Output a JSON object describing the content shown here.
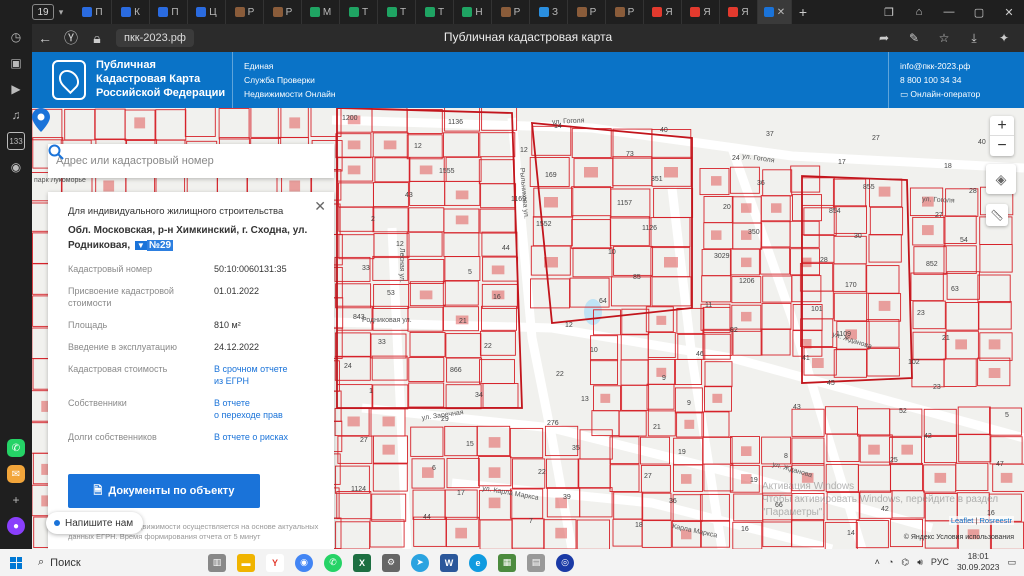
{
  "browser": {
    "tab_count": "19",
    "tabs": [
      {
        "label": "П",
        "color": "#2a6be0"
      },
      {
        "label": "К",
        "color": "#2a6be0"
      },
      {
        "label": "П",
        "color": "#2a6be0"
      },
      {
        "label": "Ц",
        "color": "#2a6be0"
      },
      {
        "label": "Р",
        "color": "#8a5c3a"
      },
      {
        "label": "Р",
        "color": "#8a5c3a"
      },
      {
        "label": "М",
        "color": "#1fa463"
      },
      {
        "label": "Т",
        "color": "#1fa463"
      },
      {
        "label": "Т",
        "color": "#1fa463"
      },
      {
        "label": "Т",
        "color": "#1fa463"
      },
      {
        "label": "Н",
        "color": "#1fa463"
      },
      {
        "label": "Р",
        "color": "#8a5c3a"
      },
      {
        "label": "З",
        "color": "#2a8fe0"
      },
      {
        "label": "Р",
        "color": "#8a5c3a"
      },
      {
        "label": "Р",
        "color": "#8a5c3a"
      },
      {
        "label": "Я",
        "color": "#e23a2e"
      },
      {
        "label": "Я",
        "color": "#e23a2e"
      },
      {
        "label": "Я",
        "color": "#e23a2e"
      }
    ],
    "url": "пкк-2023.рф",
    "page_title": "Публичная кадастровая карта"
  },
  "header": {
    "brand_line1": "Публичная",
    "brand_line2": "Кадастровая Карта",
    "brand_line3": "Российской Федерации",
    "service_line1": "Единая",
    "service_line2": "Служба Проверки",
    "service_line3": "Недвижимости Онлайн",
    "email": "info@пкк-2023.рф",
    "phone": "8 800 100 34 34",
    "operator": "Онлайн-оператор"
  },
  "search": {
    "placeholder": "Адрес или кадастровый номер"
  },
  "card": {
    "purpose": "Для индивидуального жилищного строительства",
    "address_text": "Обл. Московская, р-н Химкинский, г. Сходна, ул. Родниковая,",
    "address_mark": "▼",
    "address_highlight": "№29",
    "rows": [
      {
        "key": "Кадастровый номер",
        "value": "50:10:0060131:35"
      },
      {
        "key": "Присвоение кадастровой стоимости",
        "value": "01.01.2022"
      },
      {
        "key": "Площадь",
        "value": "810 м²"
      },
      {
        "key": "Введение в эксплуатацию",
        "value": "24.12.2022"
      }
    ],
    "cost_key": "Кадастровая стоимость",
    "cost_link1": "В срочном отчете",
    "cost_link2": "из ЕГРН",
    "owners_key": "Собственники",
    "owners_link1": "В отчете",
    "owners_link2": "о переходе прав",
    "debts_key": "Долги собственников",
    "debts_link": "В отчете о рисках",
    "docs_button": "Документы по объекту",
    "footnote": "...ние сведений о недвижимости осуществляется на основе актуальных данных ЕГРН. Время формирования отчета от 5 минут",
    "chat_button": "Напишите нам"
  },
  "map": {
    "zoom_in": "+",
    "zoom_out": "−",
    "attribution_leaflet": "Leaflet",
    "attribution_rosreestr": "Rosreestr",
    "yandex_copy": "© Яндекс Условия использования",
    "watermark_line1": "Активация Windows",
    "watermark_line2": "Чтобы активировать Windows, перейдите в раздел",
    "watermark_line3": "\"Параметры\".",
    "streets": [
      "ул. Гоголя",
      "ул. Гоголя",
      "ул. Гоголя",
      "Родниковая ул.",
      "ул. Жданова",
      "ул. Заречная",
      "ул. Карла Маркса",
      "ул. Жданова",
      "Рыльникова ул.",
      "Лесная ул.",
      "парк Лукоморье",
      "Карла Маркса"
    ],
    "parcel_numbers": [
      "1200",
      "1555",
      "1552",
      "85",
      "82",
      "45",
      "42",
      "1124",
      "1136",
      "169",
      "1126",
      "1206",
      "1109",
      "23",
      "27",
      "17",
      "14",
      "351",
      "350",
      "170",
      "21",
      "1",
      "15",
      "39",
      "40",
      "36",
      "30",
      "63",
      "33",
      "34",
      "35",
      "36",
      "37",
      "855",
      "54",
      "53",
      "22",
      "13",
      "19",
      "66",
      "27",
      "28",
      "12",
      "16",
      "10",
      "9",
      "8",
      "42",
      "40",
      "43",
      "44",
      "64",
      "46",
      "43",
      "25",
      "16",
      "12",
      "1169",
      "10",
      "11",
      "41",
      "52",
      "47",
      "44",
      "12",
      "1157",
      "3029",
      "101",
      "102",
      "5",
      "6",
      "7",
      "73",
      "20",
      "28",
      "23",
      "24",
      "29",
      "22",
      "18",
      "24",
      "854",
      "852",
      "843",
      "866",
      "276",
      "27",
      "16",
      "17",
      "27",
      "33",
      "21",
      "22",
      "21",
      "19",
      "14",
      "18",
      "2",
      "5",
      "12",
      "9"
    ]
  },
  "taskbar": {
    "search_label": "Поиск",
    "lang": "РУС",
    "time": "18:01",
    "date": "30.09.2023"
  }
}
